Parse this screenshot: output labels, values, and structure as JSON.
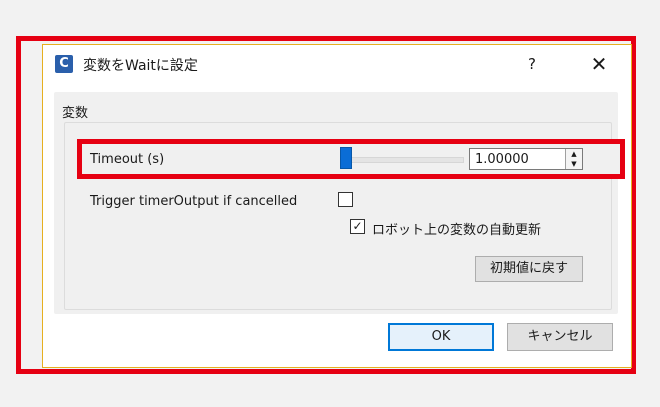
{
  "dialog": {
    "icon_letter": "C",
    "title": "変数をWaitに設定",
    "help_label": "?",
    "close_label": "✕"
  },
  "group": {
    "label": "変数"
  },
  "timeout": {
    "label": "Timeout (s)",
    "value": "1.00000",
    "slider_level": 0.0
  },
  "trigger": {
    "label": "Trigger timerOutput if cancelled",
    "checked": false
  },
  "auto_update": {
    "label": "ロボット上の変数の自動更新",
    "checked": true
  },
  "buttons": {
    "reset": "初期値に戻す",
    "ok": "OK",
    "cancel": "キャンセル"
  },
  "colors": {
    "highlight": "#e60012",
    "accent": "#0a6dd6",
    "dialog_border": "#e6b020"
  }
}
